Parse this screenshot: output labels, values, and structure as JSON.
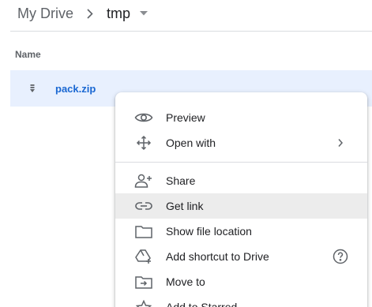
{
  "breadcrumb": {
    "root": "My Drive",
    "current": "tmp"
  },
  "list": {
    "column_name": "Name",
    "file": {
      "name": "pack.zip",
      "icon": "zip-file-icon"
    }
  },
  "context_menu": {
    "group1": [
      {
        "label": "Preview",
        "icon": "eye-icon"
      },
      {
        "label": "Open with",
        "icon": "move-arrows-icon",
        "has_submenu": true
      }
    ],
    "group2": [
      {
        "label": "Share",
        "icon": "person-add-icon"
      },
      {
        "label": "Get link",
        "icon": "link-icon",
        "highlighted": true
      },
      {
        "label": "Show file location",
        "icon": "folder-icon"
      },
      {
        "label": "Add shortcut to Drive",
        "icon": "drive-shortcut-icon",
        "help": true
      },
      {
        "label": "Move to",
        "icon": "move-to-folder-icon"
      },
      {
        "label": "Add to Starred",
        "icon": "star-icon"
      }
    ]
  },
  "colors": {
    "selection_bg": "#e8f0fe",
    "file_name": "#1967d2",
    "hover_bg": "#ececec",
    "icon": "#5f6368"
  }
}
